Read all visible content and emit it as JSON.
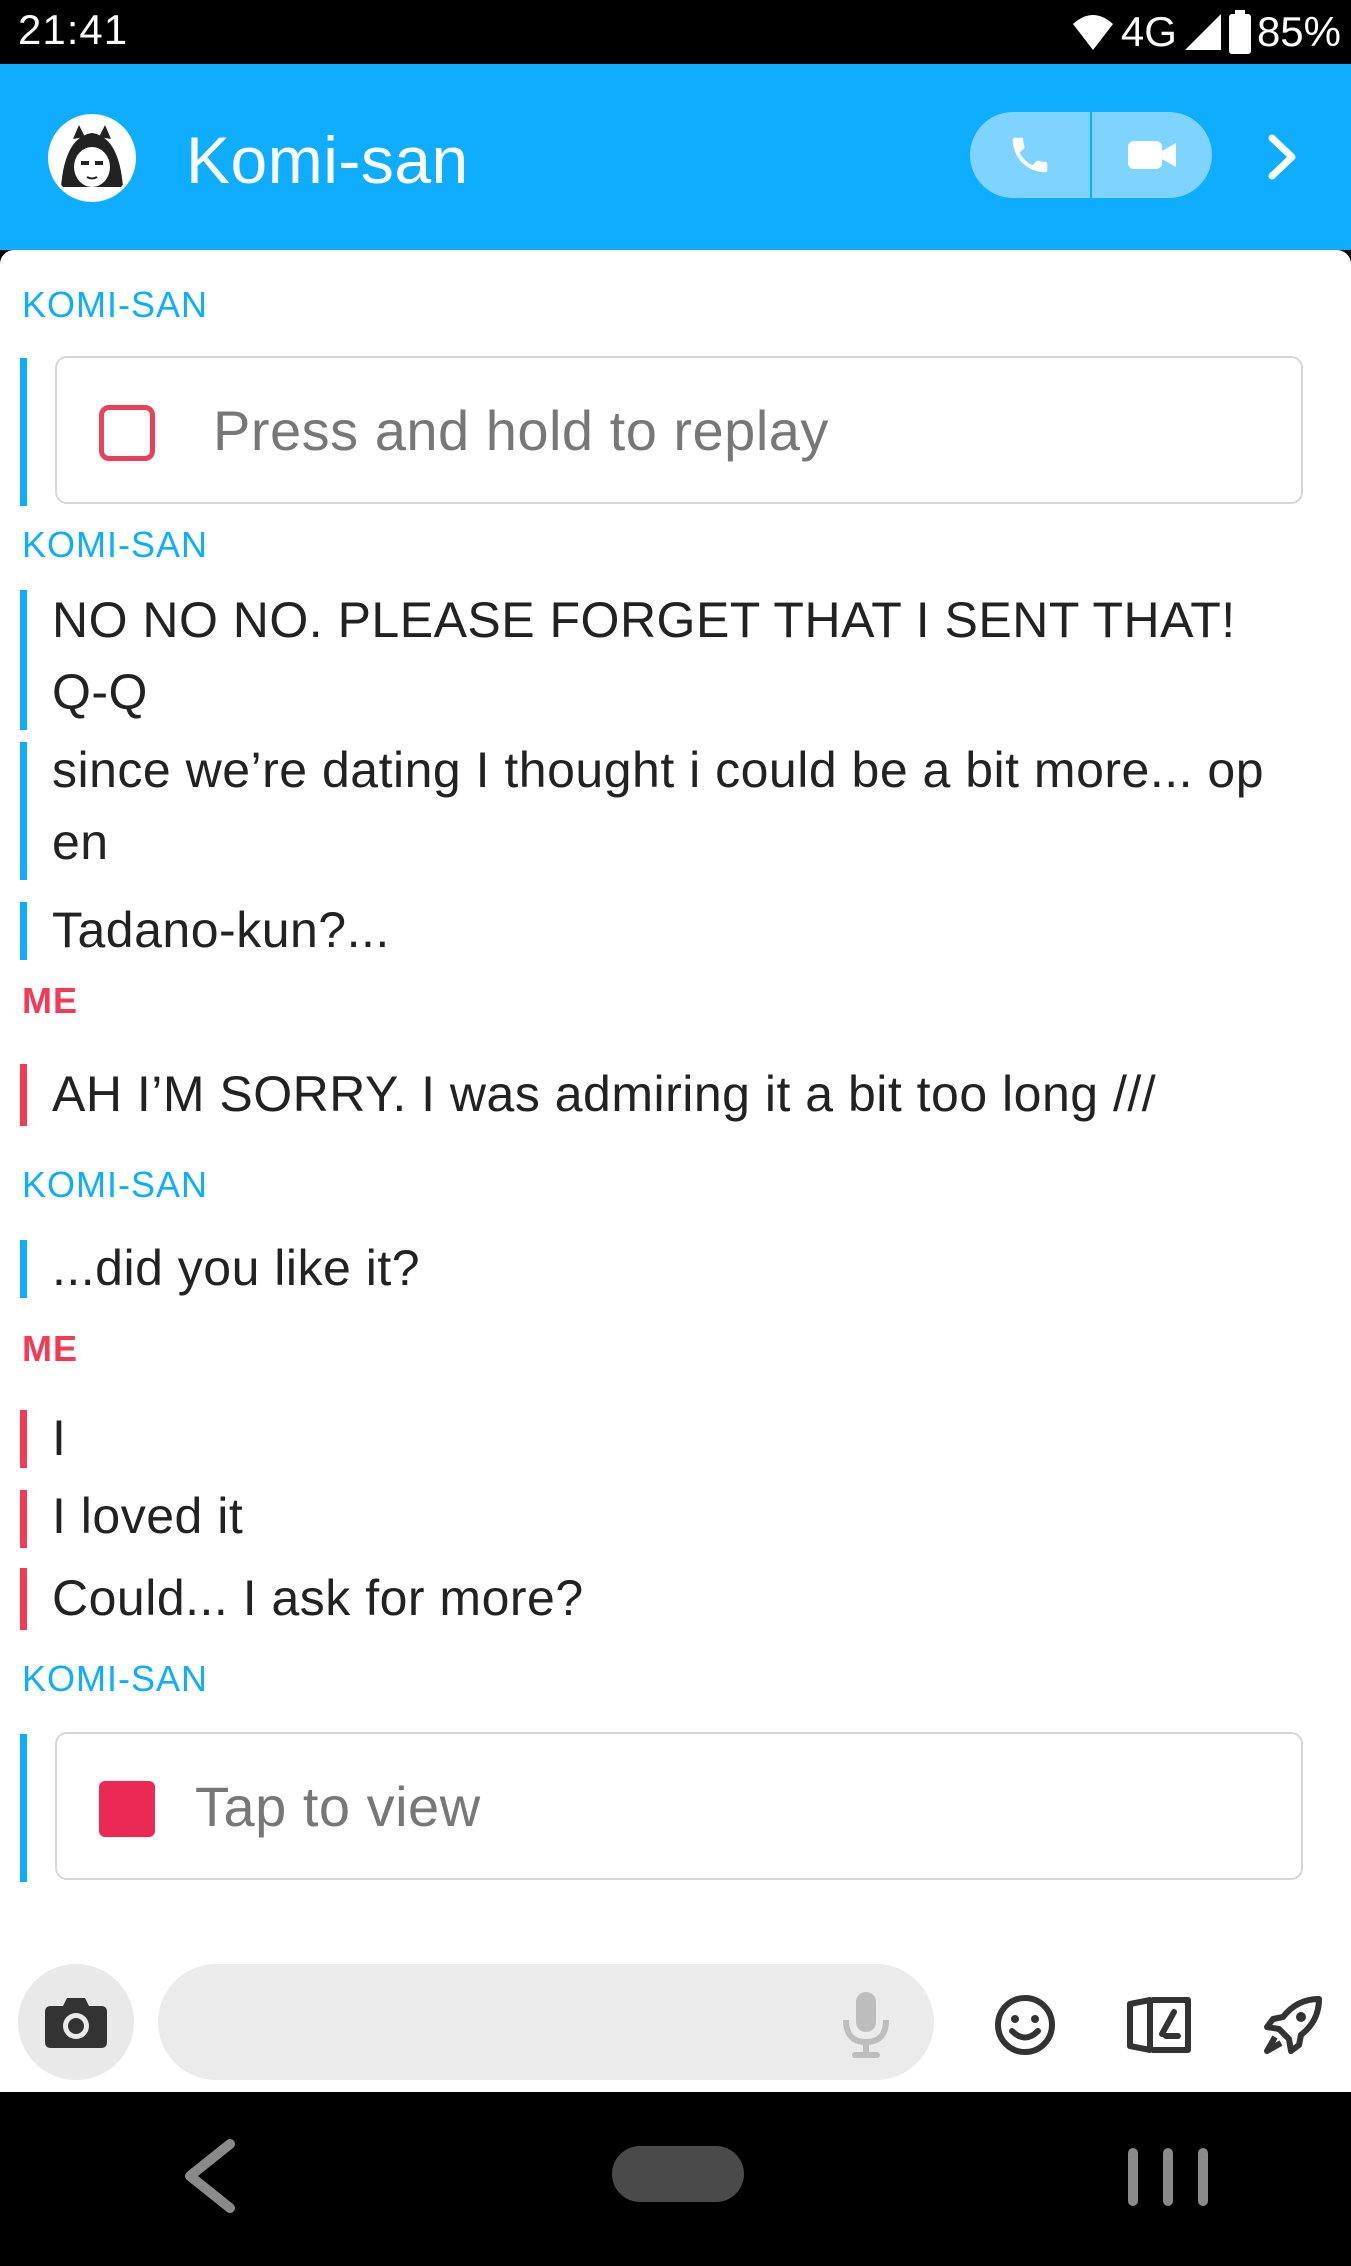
{
  "status_bar": {
    "time": "21:41",
    "network": "4G",
    "battery": "85%",
    "icons": [
      "wifi-icon",
      "signal-icon",
      "battery-icon"
    ]
  },
  "header": {
    "contact_name": "Komi-san",
    "buttons": [
      "phone-icon",
      "video-camera-icon",
      "chevron-right-icon"
    ],
    "accent_color": "#0eadff"
  },
  "conversation": {
    "friend_label": "KOMI-SAN",
    "me_label": "ME",
    "friend_color": "#0eadff",
    "me_color": "#f23c57",
    "snap_replay": "Press and hold to replay",
    "messages_1_line_1": "NO NO NO. PLEASE FORGET THAT I SENT THAT!",
    "messages_1_line_2": "Q-Q",
    "messages_2_line_1": "since we’re dating I thought i could be a bit more... op",
    "messages_2_line_2": "en",
    "messages_3": "Tadano-kun?...",
    "messages_4": "AH I’M SORRY. I was admiring it a bit too long ///",
    "messages_5": "...did you like it?",
    "messages_6": "I",
    "messages_7": "I loved it",
    "messages_8": "Could... I ask for more?",
    "snap_view": "Tap to view"
  },
  "compose": {
    "placeholder": "",
    "icons": [
      "camera-icon",
      "microphone-icon",
      "emoji-icon",
      "sticker-icon",
      "rocket-icon"
    ]
  },
  "navbar": {
    "icons": [
      "back-icon",
      "home-icon",
      "recents-icon"
    ]
  }
}
